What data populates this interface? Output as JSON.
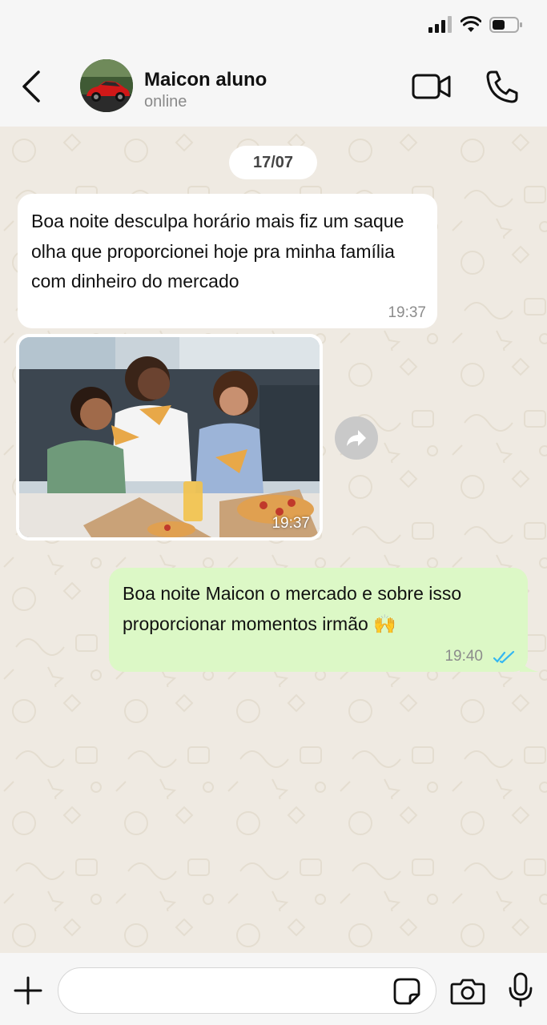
{
  "header": {
    "contact_name": "Maicon aluno",
    "contact_status": "online"
  },
  "chat": {
    "date_label": "17/07",
    "messages": [
      {
        "direction": "incoming",
        "type": "text",
        "text": "Boa noite desculpa horário mais fiz um saque olha que proporcionei hoje pra minha família com dinheiro do mercado",
        "time": "19:37"
      },
      {
        "direction": "incoming",
        "type": "image",
        "image_description": "family-eating-pizza-photo",
        "time": "19:37"
      },
      {
        "direction": "outgoing",
        "type": "text",
        "text": "Boa noite Maicon o mercado e sobre isso proporcionar momentos irmão 🙌",
        "time": "19:40",
        "read_status": "read"
      }
    ]
  },
  "input": {
    "placeholder": "",
    "value": ""
  },
  "icons": {
    "back": "chevron-left-icon",
    "video_call": "video-camera-icon",
    "voice_call": "phone-icon",
    "forward": "forward-arrow-icon",
    "attach": "plus-icon",
    "sticker": "sticker-icon",
    "camera": "camera-icon",
    "mic": "microphone-icon",
    "read_receipt": "double-check-icon"
  },
  "colors": {
    "outgoing_bubble": "#dcf8c6",
    "incoming_bubble": "#ffffff",
    "chat_background": "#efeae2",
    "read_tick": "#34b7f1"
  }
}
